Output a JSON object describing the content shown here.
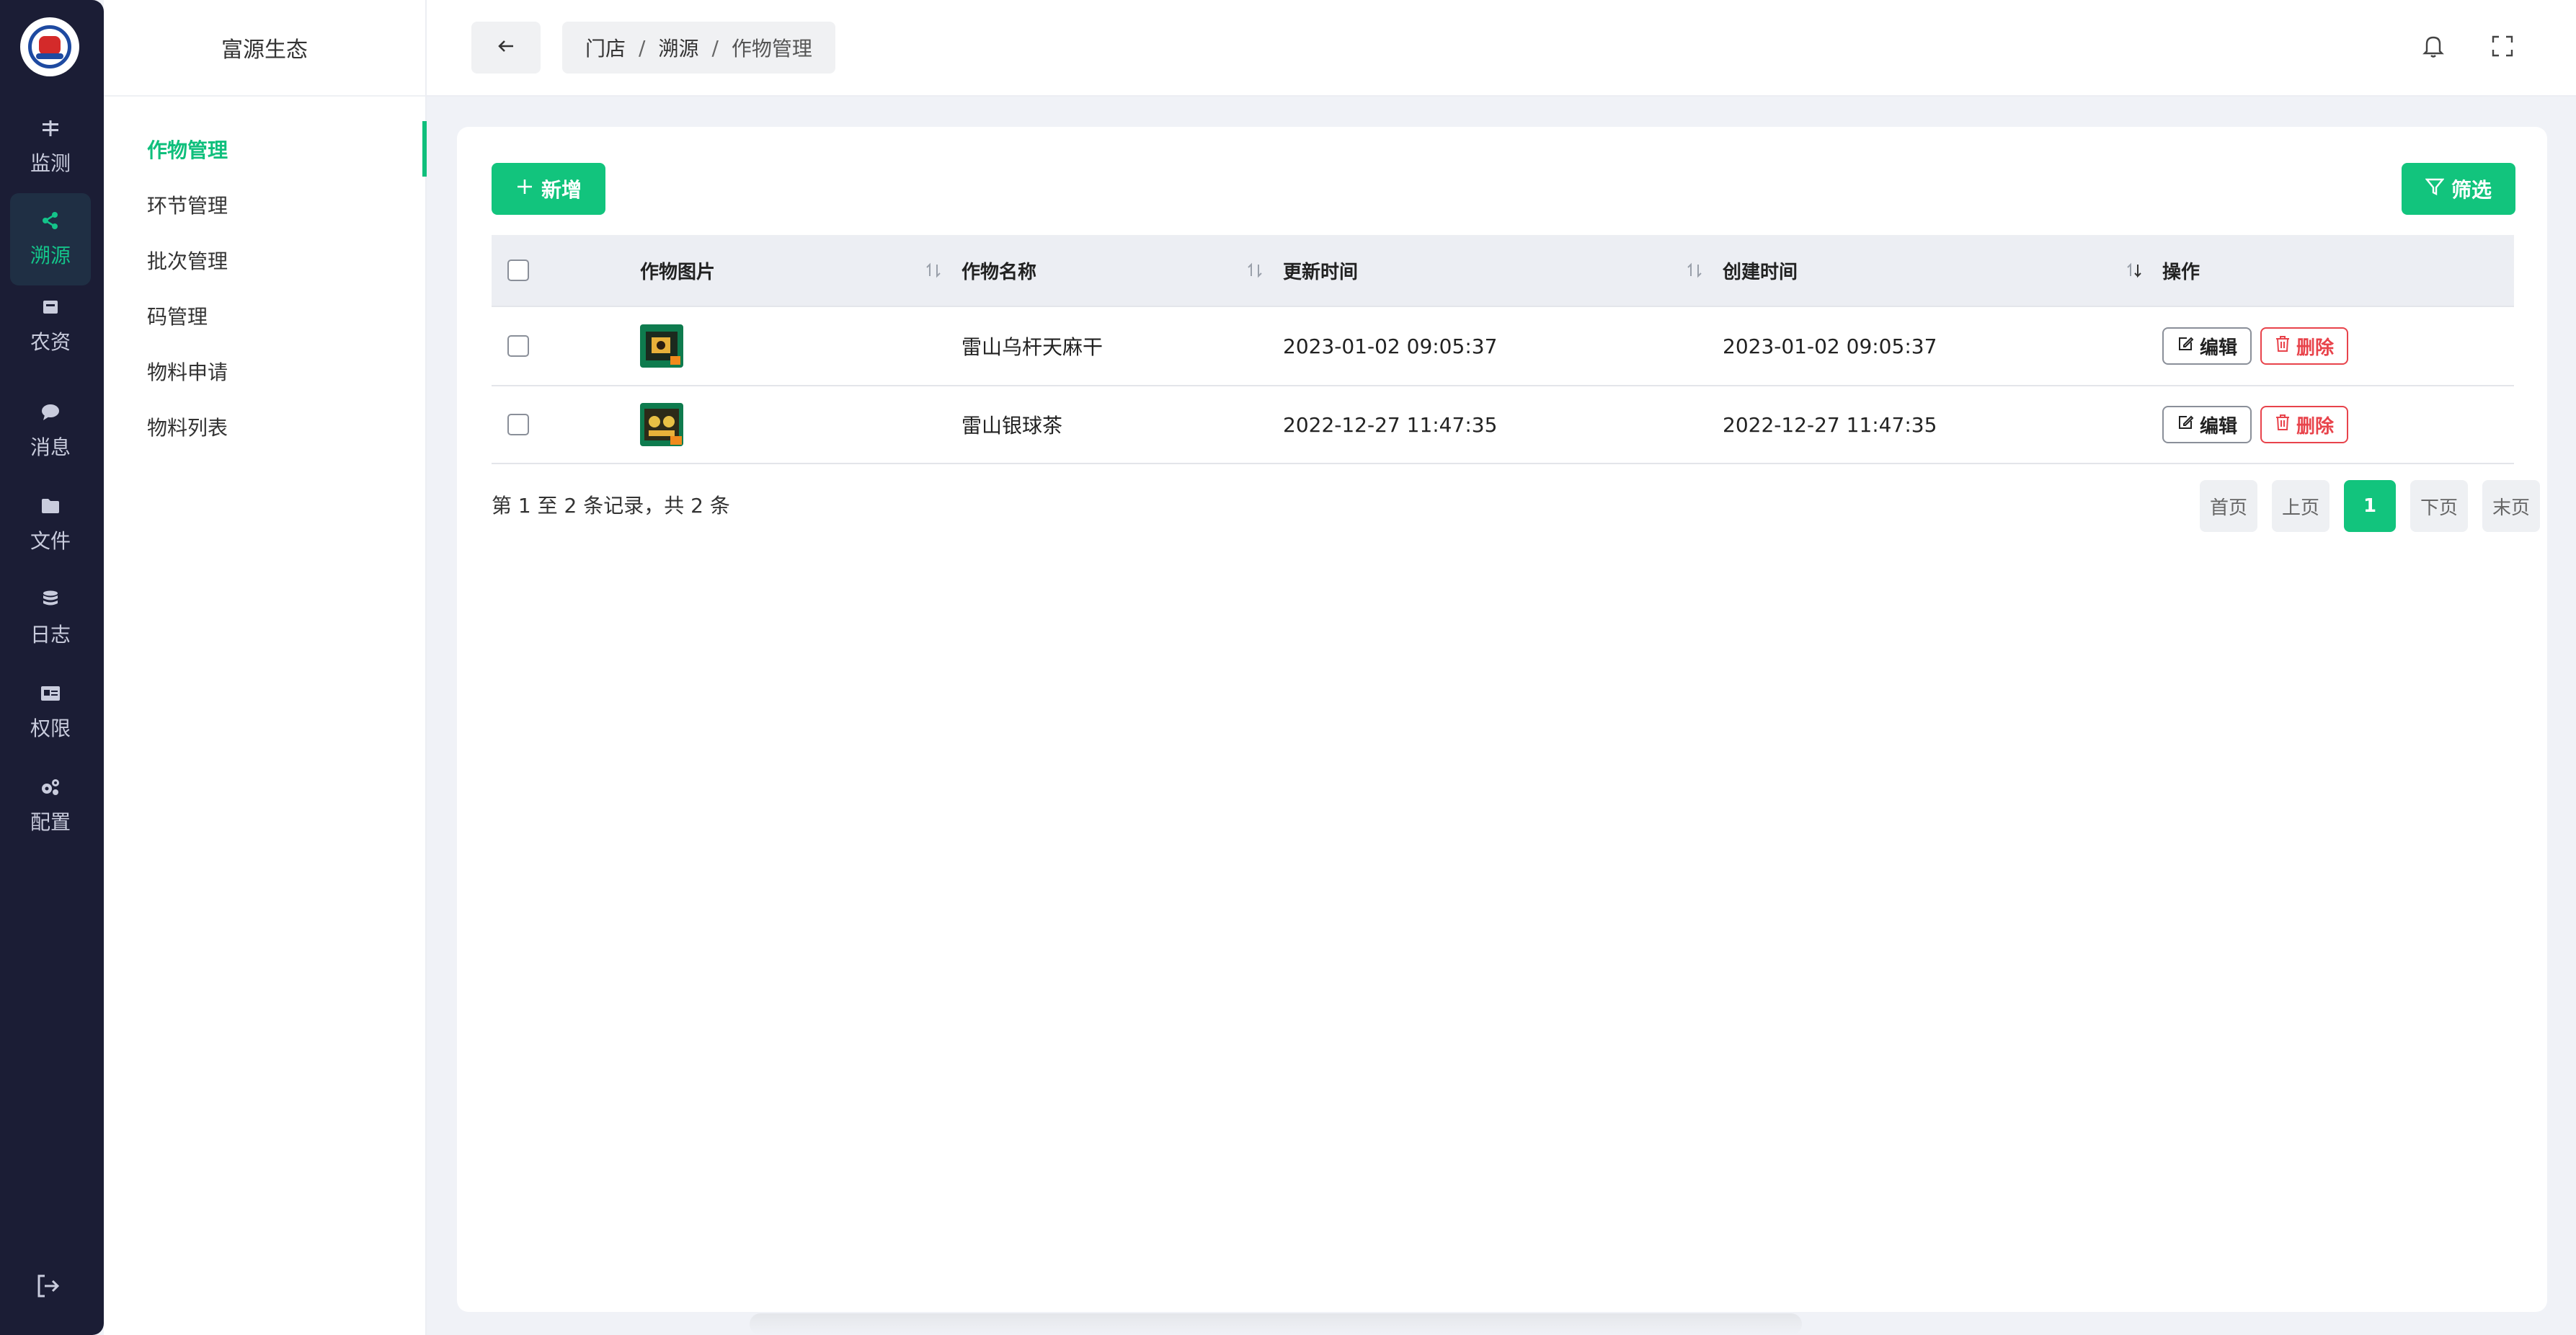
{
  "rail": {
    "items": [
      {
        "label": "监测",
        "icon": "equal-icon",
        "active": false
      },
      {
        "label": "溯源",
        "icon": "share-icon",
        "active": true
      },
      {
        "label": "农资",
        "icon": "box-icon",
        "active": false
      },
      {
        "label": "消息",
        "icon": "chat-icon",
        "active": false
      },
      {
        "label": "文件",
        "icon": "folder-icon",
        "active": false
      },
      {
        "label": "日志",
        "icon": "database-icon",
        "active": false
      },
      {
        "label": "权限",
        "icon": "id-card-icon",
        "active": false
      },
      {
        "label": "配置",
        "icon": "gears-icon",
        "active": false
      }
    ]
  },
  "submenu": {
    "title": "富源生态",
    "items": [
      "作物管理",
      "环节管理",
      "批次管理",
      "码管理",
      "物料申请",
      "物料列表"
    ]
  },
  "header": {
    "breadcrumb": [
      "门店",
      "溯源",
      "作物管理"
    ],
    "separator": "/"
  },
  "toolbar": {
    "add_label": "新增",
    "filter_label": "筛选"
  },
  "table": {
    "columns": [
      "作物图片",
      "作物名称",
      "更新时间",
      "创建时间",
      "操作"
    ],
    "rows": [
      {
        "name": "雷山乌杆天麻干",
        "updated": "2023-01-02 09:05:37",
        "created": "2023-01-02 09:05:37"
      },
      {
        "name": "雷山银球茶",
        "updated": "2022-12-27 11:47:35",
        "created": "2022-12-27 11:47:35"
      }
    ],
    "edit_label": "编辑",
    "delete_label": "删除"
  },
  "footer": {
    "records_text": "第 1 至 2 条记录，共 2 条",
    "pager": {
      "first": "首页",
      "prev": "上页",
      "current": "1",
      "next": "下页",
      "last": "末页"
    }
  },
  "colors": {
    "accent": "#12c47d",
    "rail_bg": "#1b1d35",
    "danger": "#e8434b"
  }
}
